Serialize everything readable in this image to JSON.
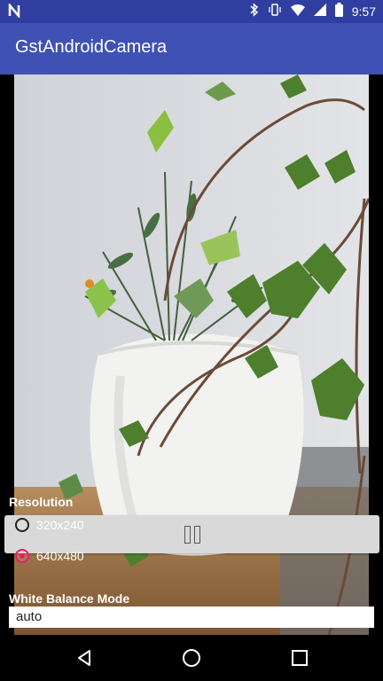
{
  "status_bar": {
    "left_icon": "notification-n-icon",
    "time": "9:57",
    "icons": [
      "bluetooth-icon",
      "vibrate-icon",
      "wifi-icon",
      "signal-icon",
      "battery-icon"
    ]
  },
  "app_bar": {
    "title": "GstAndroidCamera"
  },
  "controls": {
    "play_pause_icon": "pause-icon"
  },
  "resolution": {
    "label": "Resolution",
    "options": [
      {
        "label": "320x240",
        "selected": false
      },
      {
        "label": "640x480",
        "selected": true
      }
    ]
  },
  "white_balance": {
    "label": "White Balance Mode",
    "value": "auto"
  },
  "nav_bar": {
    "icons": [
      "back-icon",
      "home-icon",
      "recents-icon"
    ]
  },
  "colors": {
    "status_bar": "#303f9f",
    "toolbar": "#3f51b5",
    "accent": "#e91e63"
  }
}
